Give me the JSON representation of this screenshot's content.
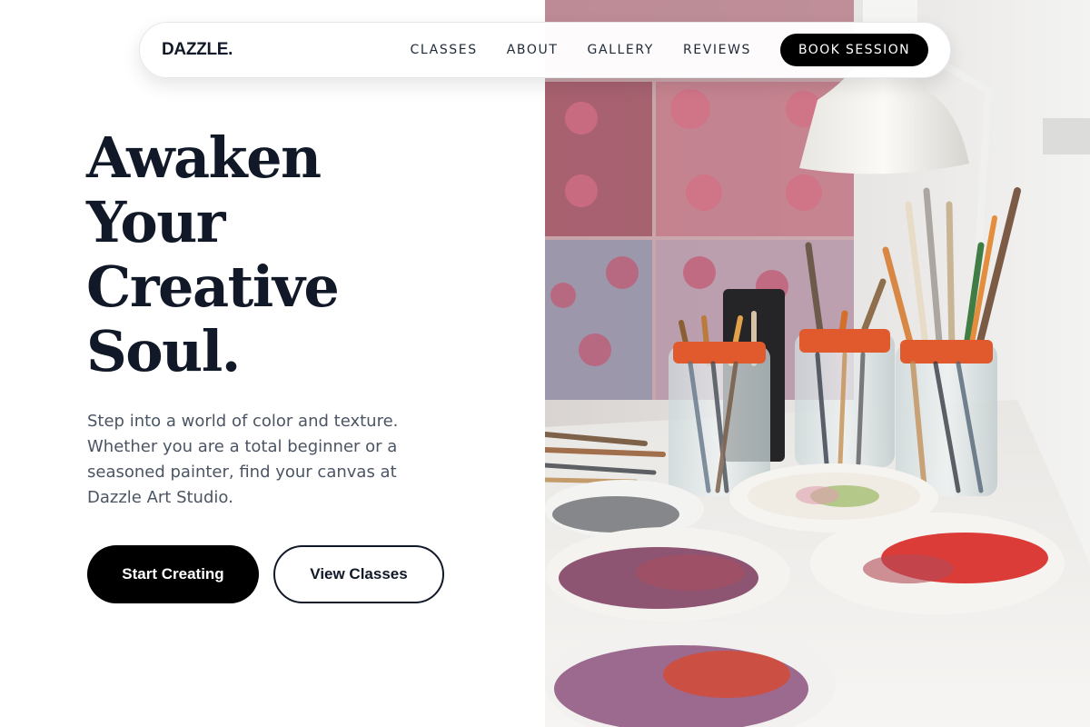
{
  "nav": {
    "logo": "DAZZLE.",
    "links": [
      "CLASSES",
      "ABOUT",
      "GALLERY",
      "REVIEWS"
    ],
    "cta": "BOOK SESSION"
  },
  "hero": {
    "headline": [
      "Awaken",
      "Your",
      "Creative",
      "Soul."
    ],
    "subtext": "Step into a world of color and texture. Whether you are a total beginner or a seasoned painter, find your canvas at Dazzle Art Studio.",
    "primary_button": "Start Creating",
    "secondary_button": "View Classes"
  },
  "colors": {
    "text_dark": "#111827",
    "text_muted": "#4b5563",
    "button_black": "#000000"
  }
}
